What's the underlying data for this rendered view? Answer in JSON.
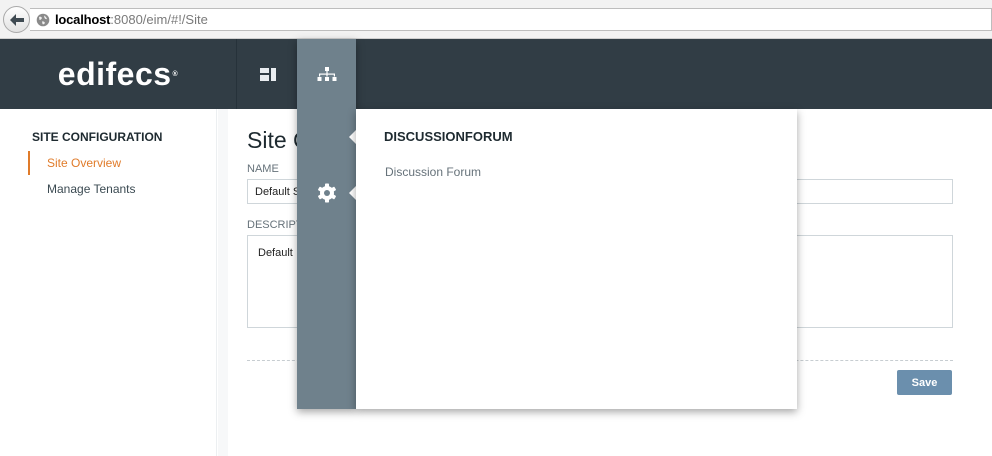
{
  "browser": {
    "url_host": "localhost",
    "url_rest": ":8080/eim/#!/Site"
  },
  "header": {
    "logo": "edifecs",
    "logo_mark": "®"
  },
  "sidebar": {
    "heading": "SITE CONFIGURATION",
    "items": [
      {
        "label": "Site Overview",
        "active": true
      },
      {
        "label": "Manage Tenants",
        "active": false
      }
    ]
  },
  "main": {
    "title": "Site C",
    "name_label": "NAME",
    "name_value": "Default S",
    "description_label": "DESCRIPT",
    "description_value": "Default",
    "save_label": "Save"
  },
  "popover": {
    "title": "DISCUSSIONFORUM",
    "link": "Discussion Forum"
  },
  "colors": {
    "header_bg": "#313d45",
    "rail_bg": "#6f818c",
    "accent": "#e07b2a",
    "save_button": "#6b8fad"
  }
}
